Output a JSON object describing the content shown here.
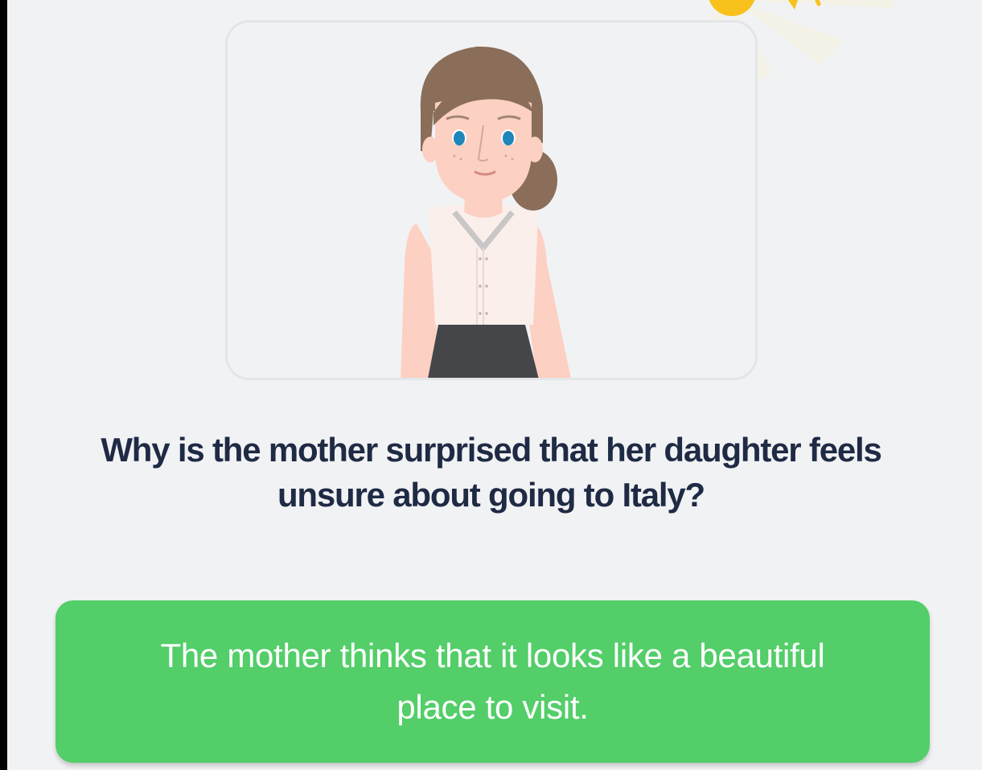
{
  "question": {
    "text": "Why is the mother surprised that her daughter feels unsure about going to Italy?"
  },
  "answer_option": {
    "label": "The mother thinks that it looks like a beautiful place to visit.",
    "state": "correct"
  },
  "character": {
    "role": "mother",
    "icon": "woman-character-illustration"
  },
  "decoration": {
    "icon": "sun-icon"
  },
  "colors": {
    "background": "#f1f2f4",
    "question_text": "#1f2a44",
    "answer_correct": "#53ce69",
    "sun": "#f8c21c",
    "hair": "#8a6e5a",
    "skin": "#fcd0c2",
    "eyes": "#1e86b8",
    "blouse": "#fbefec",
    "skirt": "#454649"
  }
}
